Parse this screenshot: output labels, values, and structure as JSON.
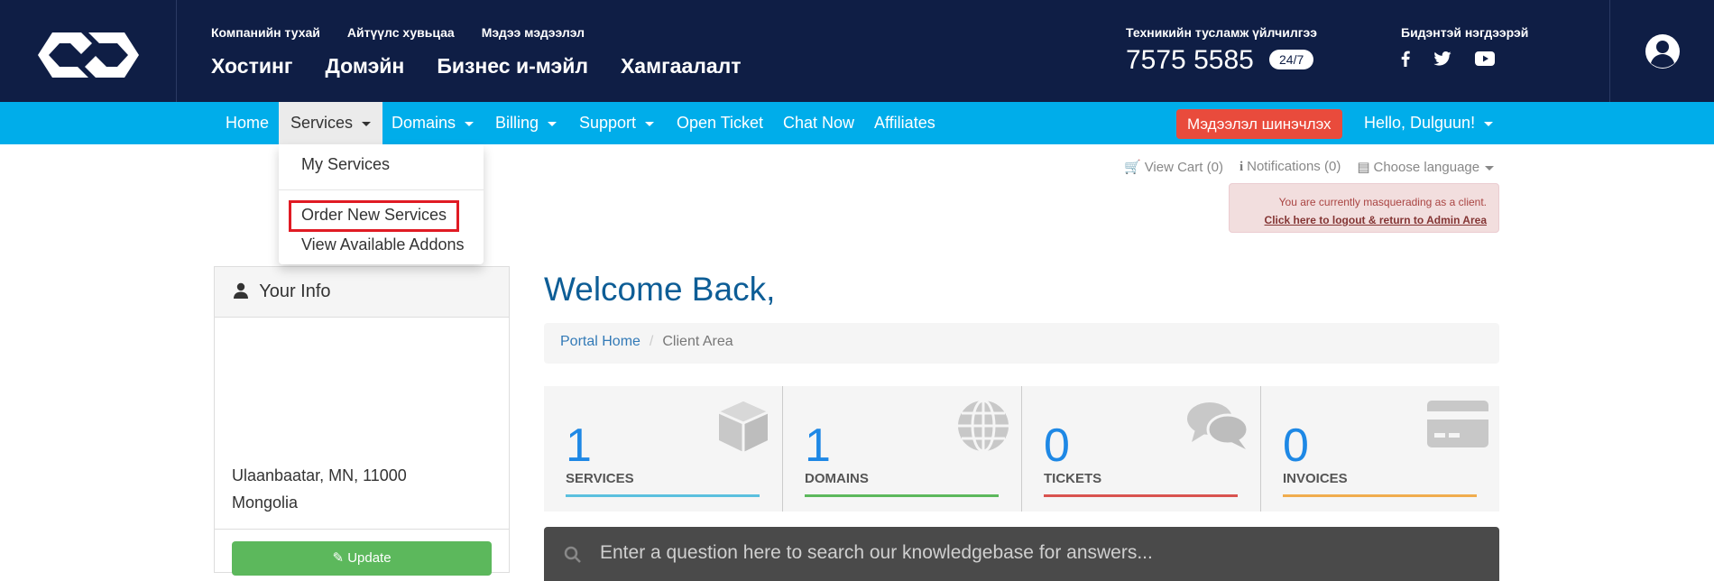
{
  "header": {
    "small_links": [
      "Компанийн тухай",
      "Айтүүлс хувьцаа",
      "Мэдээ мэдээлэл"
    ],
    "big_links": [
      "Хостинг",
      "Домэйн",
      "Бизнес и-мэйл",
      "Хамгаалалт"
    ],
    "support_label": "Техникийн тусламж үйлчилгээ",
    "phone": "7575 5585",
    "badge": "24/7",
    "contact_label": "Бидэнтэй нэгдээрэй",
    "social_icons": [
      "facebook-icon",
      "twitter-icon",
      "youtube-icon"
    ]
  },
  "nav": {
    "home": "Home",
    "services": "Services",
    "domains": "Domains",
    "billing": "Billing",
    "support": "Support",
    "open_ticket": "Open Ticket",
    "chat_now": "Chat Now",
    "affiliates": "Affiliates",
    "update_button": "Мэдээлэл шинэчлэх",
    "hello": "Hello, Dulguun!"
  },
  "services_menu": {
    "items": [
      "My Services",
      "Order New Services",
      "View Available Addons"
    ]
  },
  "utility": {
    "cart": "View Cart (0)",
    "notifications": "Notifications (0)",
    "language": "Choose language"
  },
  "masquerade": {
    "line1": "You are currently masquerading as a client.",
    "link": "Click here to logout & return to Admin Area"
  },
  "info_panel": {
    "title": "Your Info",
    "city_line": "Ulaanbaatar, MN, 11000",
    "country": "Mongolia",
    "update_button": "Update"
  },
  "main": {
    "welcome": "Welcome Back,",
    "breadcrumb": [
      "Portal Home",
      "Client Area"
    ],
    "tiles": [
      {
        "count": "1",
        "label": "SERVICES",
        "color": "#5bc0de",
        "icon": "cube-icon"
      },
      {
        "count": "1",
        "label": "DOMAINS",
        "color": "#5cb85c",
        "icon": "globe-icon"
      },
      {
        "count": "0",
        "label": "TICKETS",
        "color": "#d9534f",
        "icon": "comments-icon"
      },
      {
        "count": "0",
        "label": "INVOICES",
        "color": "#f0ad4e",
        "icon": "credit-card-icon"
      }
    ],
    "kb_placeholder": "Enter a question here to search our knowledgebase for answers..."
  }
}
